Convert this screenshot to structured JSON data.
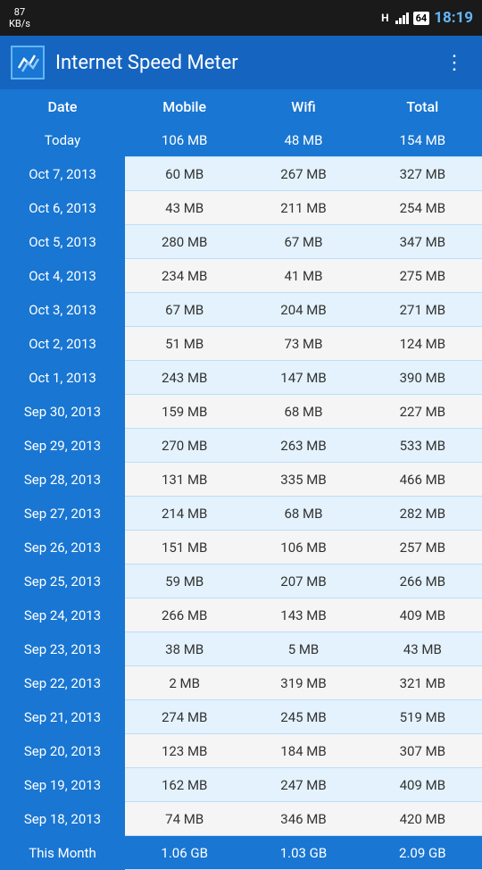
{
  "statusBar": {
    "speed": "87",
    "speedUnit": "KB/s",
    "network": "H",
    "battery": "64",
    "time": "18:19"
  },
  "appBar": {
    "title": "Internet Speed Meter",
    "menuIcon": "⋮"
  },
  "table": {
    "headers": [
      "Date",
      "Mobile",
      "Wifi",
      "Total"
    ],
    "rows": [
      {
        "date": "Today",
        "mobile": "106 MB",
        "wifi": "48 MB",
        "total": "154 MB",
        "type": "today"
      },
      {
        "date": "Oct 7, 2013",
        "mobile": "60 MB",
        "wifi": "267 MB",
        "total": "327 MB",
        "type": "odd"
      },
      {
        "date": "Oct 6, 2013",
        "mobile": "43 MB",
        "wifi": "211 MB",
        "total": "254 MB",
        "type": "even"
      },
      {
        "date": "Oct 5, 2013",
        "mobile": "280 MB",
        "wifi": "67 MB",
        "total": "347 MB",
        "type": "odd"
      },
      {
        "date": "Oct 4, 2013",
        "mobile": "234 MB",
        "wifi": "41 MB",
        "total": "275 MB",
        "type": "even"
      },
      {
        "date": "Oct 3, 2013",
        "mobile": "67 MB",
        "wifi": "204 MB",
        "total": "271 MB",
        "type": "odd"
      },
      {
        "date": "Oct 2, 2013",
        "mobile": "51 MB",
        "wifi": "73 MB",
        "total": "124 MB",
        "type": "even"
      },
      {
        "date": "Oct 1, 2013",
        "mobile": "243 MB",
        "wifi": "147 MB",
        "total": "390 MB",
        "type": "odd"
      },
      {
        "date": "Sep 30, 2013",
        "mobile": "159 MB",
        "wifi": "68 MB",
        "total": "227 MB",
        "type": "even"
      },
      {
        "date": "Sep 29, 2013",
        "mobile": "270 MB",
        "wifi": "263 MB",
        "total": "533 MB",
        "type": "odd"
      },
      {
        "date": "Sep 28, 2013",
        "mobile": "131 MB",
        "wifi": "335 MB",
        "total": "466 MB",
        "type": "even"
      },
      {
        "date": "Sep 27, 2013",
        "mobile": "214 MB",
        "wifi": "68 MB",
        "total": "282 MB",
        "type": "odd"
      },
      {
        "date": "Sep 26, 2013",
        "mobile": "151 MB",
        "wifi": "106 MB",
        "total": "257 MB",
        "type": "even"
      },
      {
        "date": "Sep 25, 2013",
        "mobile": "59 MB",
        "wifi": "207 MB",
        "total": "266 MB",
        "type": "odd"
      },
      {
        "date": "Sep 24, 2013",
        "mobile": "266 MB",
        "wifi": "143 MB",
        "total": "409 MB",
        "type": "even"
      },
      {
        "date": "Sep 23, 2013",
        "mobile": "38 MB",
        "wifi": "5 MB",
        "total": "43 MB",
        "type": "odd"
      },
      {
        "date": "Sep 22, 2013",
        "mobile": "2 MB",
        "wifi": "319 MB",
        "total": "321 MB",
        "type": "even"
      },
      {
        "date": "Sep 21, 2013",
        "mobile": "274 MB",
        "wifi": "245 MB",
        "total": "519 MB",
        "type": "odd"
      },
      {
        "date": "Sep 20, 2013",
        "mobile": "123 MB",
        "wifi": "184 MB",
        "total": "307 MB",
        "type": "even"
      },
      {
        "date": "Sep 19, 2013",
        "mobile": "162 MB",
        "wifi": "247 MB",
        "total": "409 MB",
        "type": "odd"
      },
      {
        "date": "Sep 18, 2013",
        "mobile": "74 MB",
        "wifi": "346 MB",
        "total": "420 MB",
        "type": "even"
      },
      {
        "date": "This Month",
        "mobile": "1.06 GB",
        "wifi": "1.03 GB",
        "total": "2.09 GB",
        "type": "month-row"
      }
    ]
  }
}
